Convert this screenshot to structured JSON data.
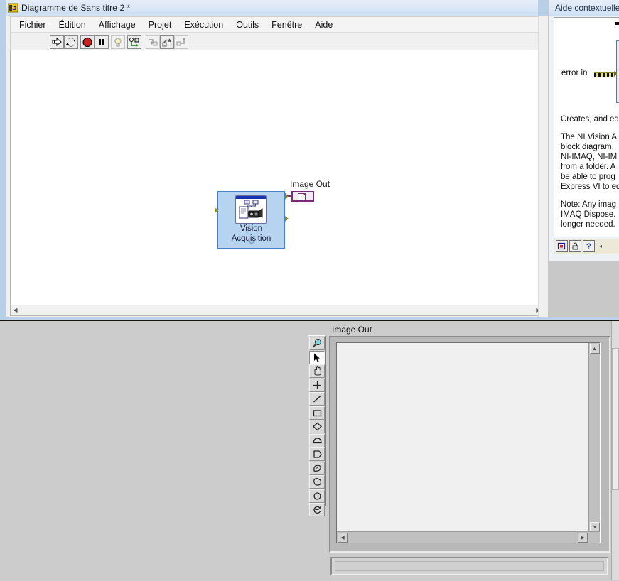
{
  "block_diagram_window": {
    "title": "Diagramme de Sans titre 2 *",
    "title_icon": "labview-diagram-icon",
    "menu": [
      {
        "label": "Fichier",
        "name": "menu-fichier"
      },
      {
        "label": "Édition",
        "name": "menu-edition"
      },
      {
        "label": "Affichage",
        "name": "menu-affichage"
      },
      {
        "label": "Projet",
        "name": "menu-projet"
      },
      {
        "label": "Exécution",
        "name": "menu-execution"
      },
      {
        "label": "Outils",
        "name": "menu-outils"
      },
      {
        "label": "Fenêtre",
        "name": "menu-fenetre"
      },
      {
        "label": "Aide",
        "name": "menu-aide"
      }
    ],
    "toolbar": [
      {
        "name": "run-button",
        "icon": "run-arrow-icon",
        "enabled": true
      },
      {
        "name": "run-continuously-button",
        "icon": "run-continuous-icon",
        "enabled": true
      },
      {
        "name": "abort-execution-button",
        "icon": "abort-stop-icon",
        "enabled": true
      },
      {
        "name": "pause-button",
        "icon": "pause-icon",
        "enabled": true
      },
      {
        "name": "highlight-execution-button",
        "icon": "lightbulb-icon",
        "enabled": false
      },
      {
        "name": "retain-wire-values-button",
        "icon": "retain-wire-values-icon",
        "enabled": true
      },
      {
        "name": "step-into-button",
        "icon": "step-into-icon",
        "enabled": false
      },
      {
        "name": "step-over-button",
        "icon": "step-over-icon",
        "enabled": false
      },
      {
        "name": "step-out-button",
        "icon": "step-out-icon",
        "enabled": false
      }
    ],
    "canvas": {
      "express_vi": {
        "label_line1": "Vision",
        "label_line2": "Acquisition",
        "icon": "vision-acquisition-icon",
        "expand_chevron": "⌄⌄"
      },
      "indicator": {
        "label": "Image Out",
        "terminal_icon": "image-indicator-terminal-icon"
      }
    },
    "scrollbar": {
      "left_arrow": "◀",
      "right_arrow": "▶"
    }
  },
  "context_help_window": {
    "title": "Aide contextuelle",
    "diagram": {
      "error_in_label": "error in",
      "node_name": "help-node-box"
    },
    "paragraphs": [
      [
        "Creates, and ed"
      ],
      [
        "The NI Vision A",
        "block diagram.",
        "NI-IMAQ, NI-IM",
        "from a folder. A",
        "be able to prog",
        "Express VI to ed"
      ],
      [
        "Note: Any imag",
        "IMAQ Dispose.",
        "longer needed."
      ]
    ],
    "toolbar": [
      {
        "name": "show-hide-optional-terminals-button",
        "icon": "terminals-icon",
        "label": ""
      },
      {
        "name": "lock-help-button",
        "icon": "lock-icon",
        "label": ""
      },
      {
        "name": "detailed-help-button",
        "icon": "question-mark-icon",
        "label": "?"
      }
    ],
    "resize_arrow": "◂"
  },
  "front_panel": {
    "title": "Image Out",
    "tools_palette": [
      {
        "name": "tool-zoom",
        "icon": "magnifier-icon",
        "active": false
      },
      {
        "name": "tool-selection",
        "icon": "arrow-cursor-icon",
        "active": true
      },
      {
        "name": "tool-pan",
        "icon": "hand-icon",
        "active": false
      },
      {
        "name": "tool-point",
        "icon": "crosshair-icon",
        "active": false
      },
      {
        "name": "tool-line",
        "icon": "line-icon",
        "active": false
      },
      {
        "name": "tool-rectangle",
        "icon": "rectangle-icon",
        "active": false
      },
      {
        "name": "tool-rotated-rectangle",
        "icon": "rotated-rectangle-icon",
        "active": false
      },
      {
        "name": "tool-oval",
        "icon": "oval-icon",
        "active": false
      },
      {
        "name": "tool-polygon",
        "icon": "polygon-icon",
        "active": false
      },
      {
        "name": "tool-freehand-region",
        "icon": "freehand-region-icon",
        "active": false
      },
      {
        "name": "tool-annulus",
        "icon": "annulus-icon",
        "active": false
      },
      {
        "name": "tool-round-region",
        "icon": "round-region-icon",
        "active": false
      },
      {
        "name": "tool-rotate-region",
        "icon": "rotate-region-icon",
        "active": false
      }
    ],
    "image_display": {
      "scroll_up": "▲",
      "scroll_down": "▼",
      "scroll_left": "◀",
      "scroll_right": "▶"
    }
  },
  "colors": {
    "titlebar": "#d8e6f6",
    "express_vi_fill": "#b6d4f0",
    "express_vi_border": "#4b7fc4",
    "indicator_border": "#7a2a7a",
    "error_wire": "#e8e84a",
    "panel_gray": "#cccccc"
  }
}
